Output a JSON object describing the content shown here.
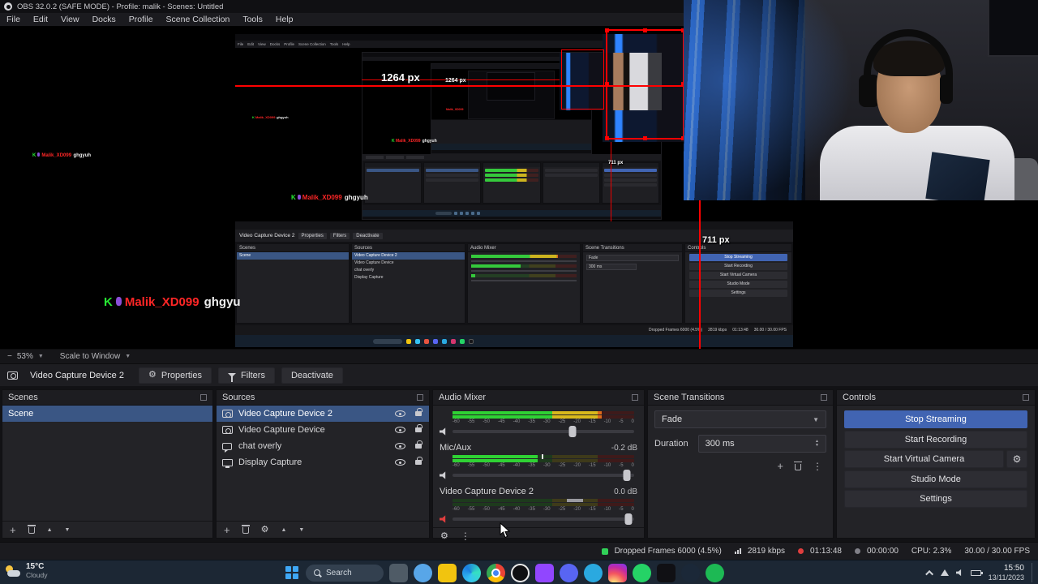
{
  "window": {
    "title": "OBS 32.0.2 (SAFE MODE) - Profile: malik - Scenes: Untitled"
  },
  "menu": {
    "items": [
      "File",
      "Edit",
      "View",
      "Docks",
      "Profile",
      "Scene Collection",
      "Tools",
      "Help"
    ]
  },
  "preview": {
    "zoom": "53%",
    "scale_mode": "Scale to Window",
    "crop_width_label": "1264 px",
    "crop_height_label": "711 px",
    "stream_overlay": {
      "k": "K",
      "name": "Malik_XD099",
      "text": "ghgyuh",
      "text_large": "ghgyu"
    }
  },
  "source_toolbar": {
    "source": "Video Capture Device 2",
    "properties": "Properties",
    "filters": "Filters",
    "deactivate": "Deactivate"
  },
  "scenes": {
    "title": "Scenes",
    "items": [
      {
        "label": "Scene",
        "state": "selected"
      }
    ]
  },
  "sources": {
    "title": "Sources",
    "items": [
      {
        "label": "Video Capture Device 2",
        "icon": "camera",
        "state": "selected"
      },
      {
        "label": "Video Capture Device",
        "icon": "camera",
        "state": ""
      },
      {
        "label": "chat overly",
        "icon": "chat",
        "state": ""
      },
      {
        "label": "Display Capture",
        "icon": "display",
        "state": ""
      }
    ]
  },
  "mixer": {
    "title": "Audio Mixer",
    "ticks": [
      "-60",
      "-55",
      "-50",
      "-45",
      "-40",
      "-35",
      "-30",
      "-25",
      "-20",
      "-15",
      "-10",
      "-5",
      "0"
    ],
    "channels": [
      {
        "name": "",
        "value": "",
        "meter_pct": 82,
        "slider_pct": 66
      },
      {
        "name": "Mic/Aux",
        "value": "-0.2 dB",
        "meter_pct": 47,
        "peak_pct": 49,
        "slider_pct": 96
      },
      {
        "name": "Video Capture Device 2",
        "value": "0.0 dB",
        "meter_pct": 0,
        "slider_pct": 97
      }
    ]
  },
  "transitions": {
    "title": "Scene Transitions",
    "transition": "Fade",
    "duration_label": "Duration",
    "duration": "300 ms"
  },
  "controls": {
    "title": "Controls",
    "stop_streaming": "Stop Streaming",
    "start_recording": "Start Recording",
    "start_virtual_camera": "Start Virtual Camera",
    "studio_mode": "Studio Mode",
    "settings": "Settings"
  },
  "statusbar": {
    "dropped_frames": "Dropped Frames 6000 (4.5%)",
    "bitrate": "2819 kbps",
    "stream_time": "01:13:48",
    "record_time": "00:00:00",
    "cpu": "CPU: 2.3%",
    "fps": "30.00 / 30.00 FPS"
  },
  "taskbar": {
    "weather_temp": "15°C",
    "weather_cond": "Cloudy",
    "search_placeholder": "Search",
    "clock_time": "15:50",
    "clock_date": "13/11/2023",
    "apps": [
      {
        "name": "task-view-icon",
        "shape": "sq",
        "bg": "#4f5b66"
      },
      {
        "name": "widgets-icon",
        "shape": "ci",
        "bg": "#58a6e8"
      },
      {
        "name": "file-explorer-icon",
        "shape": "sq",
        "bg": "#f1c40f"
      },
      {
        "name": "edge-icon",
        "shape": "ci special-edge",
        "bg": ""
      },
      {
        "name": "chrome-icon",
        "shape": "ci special-chrome",
        "bg": ""
      },
      {
        "name": "obs-icon",
        "shape": "ci special-obs",
        "bg": ""
      },
      {
        "name": "twitch-icon",
        "shape": "sq",
        "bg": "#9146ff"
      },
      {
        "name": "discord-icon",
        "shape": "ci",
        "bg": "#5865f2"
      },
      {
        "name": "telegram-icon",
        "shape": "ci",
        "bg": "#2aa9e0"
      },
      {
        "name": "instagram-icon",
        "shape": "sq special-insta",
        "bg": ""
      },
      {
        "name": "whatsapp-icon",
        "shape": "ci",
        "bg": "#25d366"
      },
      {
        "name": "tiktok-icon",
        "shape": "sq",
        "bg": "#101014"
      },
      {
        "name": "steam-icon",
        "shape": "ci",
        "bg": "#1b2838"
      },
      {
        "name": "spotify-icon",
        "shape": "ci",
        "bg": "#1db954"
      }
    ]
  }
}
